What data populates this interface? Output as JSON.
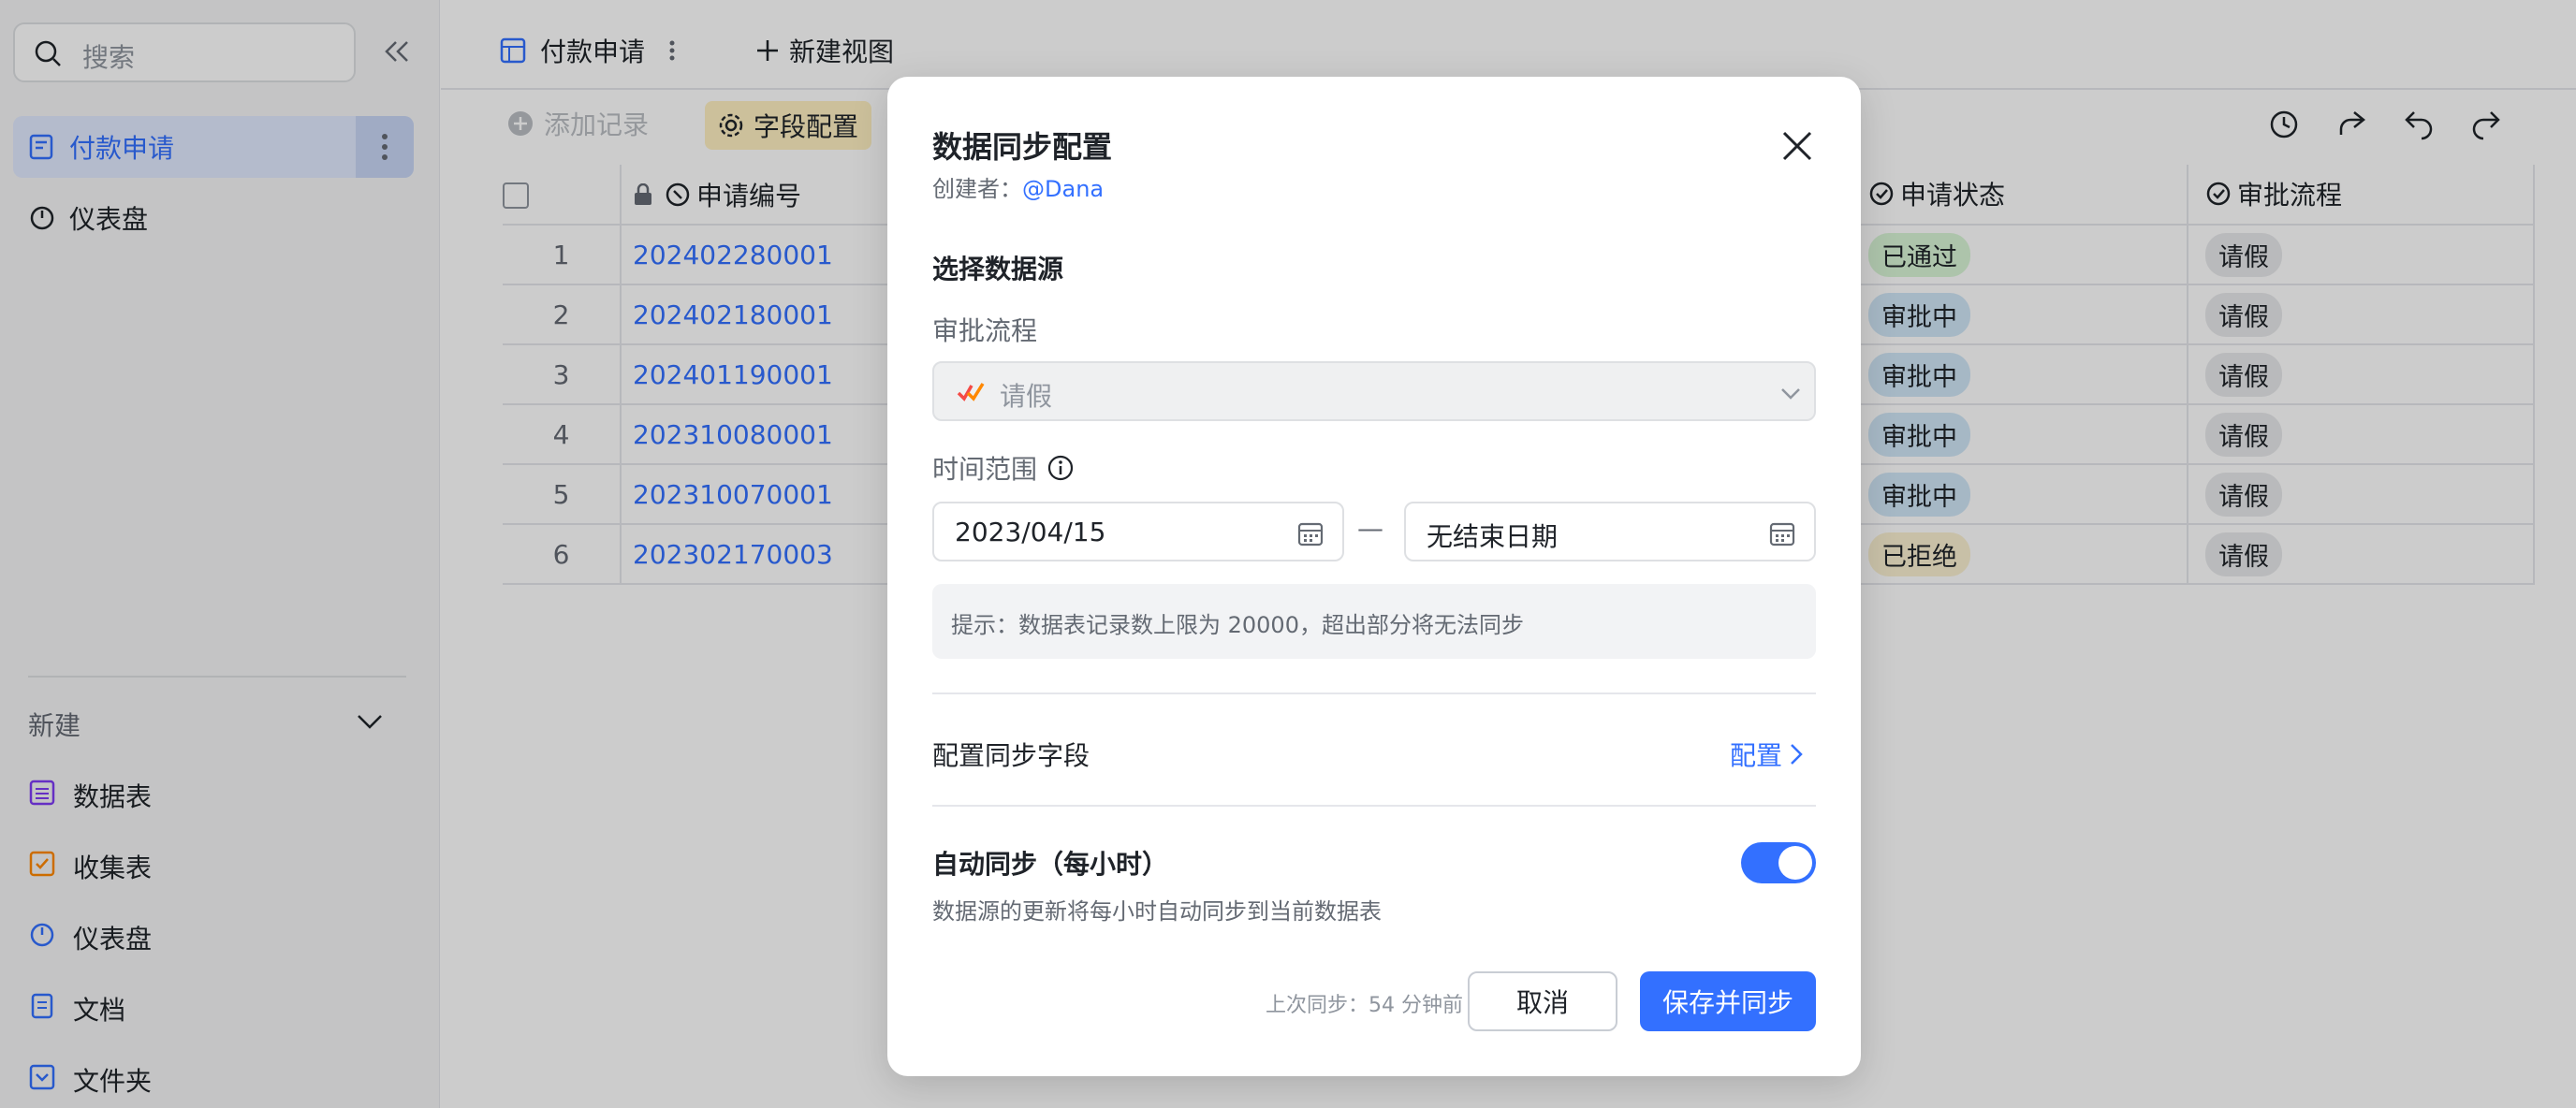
{
  "sidebar": {
    "search_placeholder": "搜索",
    "items": [
      {
        "label": "付款申请"
      },
      {
        "label": "仪表盘"
      }
    ],
    "new_section_label": "新建",
    "new_items": [
      {
        "label": "数据表"
      },
      {
        "label": "收集表"
      },
      {
        "label": "仪表盘"
      },
      {
        "label": "文档"
      },
      {
        "label": "文件夹"
      }
    ]
  },
  "main": {
    "tabs": [
      {
        "label": "付款申请"
      }
    ],
    "new_view_label": "新建视图",
    "toolbar": {
      "add_record_label": "添加记录",
      "field_config_label": "字段配置"
    },
    "table": {
      "columns": [
        "申请编号",
        "申请状态",
        "审批流程"
      ],
      "rows": [
        {
          "num": "1",
          "id": "202402280001",
          "status": "已通过",
          "flow": "请假"
        },
        {
          "num": "2",
          "id": "202402180001",
          "status": "审批中",
          "flow": "请假"
        },
        {
          "num": "3",
          "id": "202401190001",
          "status": "审批中",
          "flow": "请假"
        },
        {
          "num": "4",
          "id": "202310080001",
          "status": "审批中",
          "flow": "请假"
        },
        {
          "num": "5",
          "id": "202310070001",
          "status": "审批中",
          "flow": "请假"
        },
        {
          "num": "6",
          "id": "202302170003",
          "status": "已拒绝",
          "flow": "请假"
        }
      ]
    }
  },
  "dialog": {
    "title": "数据同步配置",
    "creator_label": "创建者：",
    "creator_name": "@Dana",
    "select_source_title": "选择数据源",
    "approval_flow_label": "审批流程",
    "approval_flow_value": "请假",
    "time_range_label": "时间范围",
    "start_date": "2023/04/15",
    "date_separator": "—",
    "end_date_placeholder": "无结束日期",
    "hint": "提示：数据表记录数上限为 20000，超出部分将无法同步",
    "config_fields_label": "配置同步字段",
    "config_link": "配置",
    "auto_sync_title": "自动同步（每小时）",
    "auto_sync_desc": "数据源的更新将每小时自动同步到当前数据表",
    "auto_sync_on": true,
    "last_sync": "上次同步：54 分钟前",
    "cancel_label": "取消",
    "save_label": "保存并同步"
  },
  "colors": {
    "accent": "#3370ff",
    "overlay": "rgba(0,0,0,0.2)"
  }
}
